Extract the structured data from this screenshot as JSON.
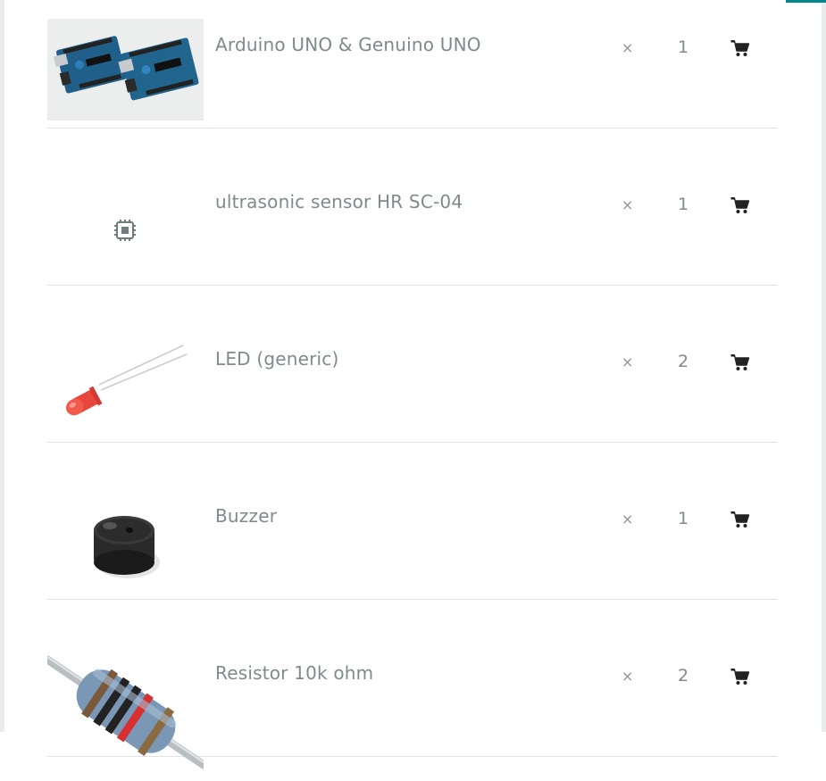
{
  "components": [
    {
      "name": "Arduino UNO & Genuino UNO",
      "times": "×",
      "quantity": "1",
      "image": "arduino-uno-board-photo",
      "cart_icon": "shopping-cart-icon"
    },
    {
      "name": "ultrasonic sensor HR SC-04",
      "times": "×",
      "quantity": "1",
      "image": "chip-icon",
      "cart_icon": "shopping-cart-icon"
    },
    {
      "name": "LED (generic)",
      "times": "×",
      "quantity": "2",
      "image": "red-led-photo",
      "cart_icon": "shopping-cart-icon"
    },
    {
      "name": "Buzzer",
      "times": "×",
      "quantity": "1",
      "image": "buzzer-photo",
      "cart_icon": "shopping-cart-icon"
    },
    {
      "name": "Resistor 10k ohm",
      "times": "×",
      "quantity": "2",
      "image": "resistor-photo",
      "cart_icon": "shopping-cart-icon"
    }
  ],
  "colors": {
    "accent": "#00878f",
    "text": "#7e8a8b",
    "divider": "#dfe3e3"
  }
}
